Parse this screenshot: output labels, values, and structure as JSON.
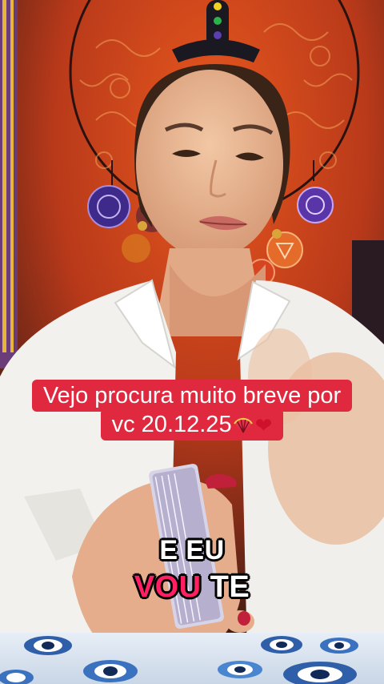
{
  "caption": {
    "line1": "Vejo procura muito breve por",
    "line2": "vc 20.12.25",
    "emoji_icons": [
      "fan-icon",
      "heart-icon"
    ],
    "background_color": "#e0293f"
  },
  "subtitle": {
    "line1": "E EU",
    "highlight": "VOU",
    "rest": "TE",
    "highlight_color": "#ff1f62"
  },
  "colors": {
    "backdrop_orange": "#d9481c",
    "coat_white": "#f2f1ee",
    "mandala_purple": "#3d2a8a"
  }
}
